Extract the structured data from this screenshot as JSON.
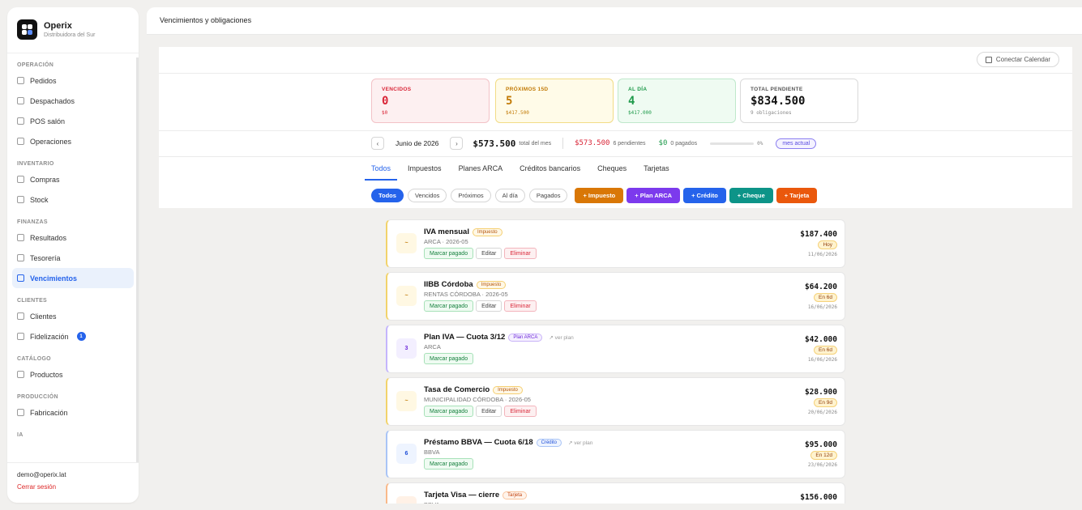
{
  "brand": {
    "name": "Operix",
    "subtitle": "Distribuidora del Sur"
  },
  "sidebar": {
    "sections": [
      {
        "title": "OPERACIÓN",
        "items": [
          {
            "label": "Pedidos",
            "icon": "box-icon"
          },
          {
            "label": "Despachados",
            "icon": "truck-icon"
          },
          {
            "label": "POS salón",
            "icon": "cart-icon"
          },
          {
            "label": "Operaciones",
            "icon": "clipboard-icon"
          }
        ]
      },
      {
        "title": "INVENTARIO",
        "items": [
          {
            "label": "Compras",
            "icon": "bag-icon"
          },
          {
            "label": "Stock",
            "icon": "stack-icon"
          }
        ]
      },
      {
        "title": "FINANZAS",
        "items": [
          {
            "label": "Resultados",
            "icon": "bar-chart-icon"
          },
          {
            "label": "Tesorería",
            "icon": "bank-icon"
          },
          {
            "label": "Vencimientos",
            "icon": "calendar-icon",
            "active": true
          }
        ]
      },
      {
        "title": "CLIENTES",
        "items": [
          {
            "label": "Clientes",
            "icon": "users-icon"
          },
          {
            "label": "Fidelización",
            "icon": "star-icon",
            "badge": "1"
          }
        ]
      },
      {
        "title": "CATÁLOGO",
        "items": [
          {
            "label": "Productos",
            "icon": "tag-icon"
          }
        ]
      },
      {
        "title": "PRODUCCIÓN",
        "items": [
          {
            "label": "Fabricación",
            "icon": "wrench-icon"
          }
        ]
      },
      {
        "title": "IA",
        "items": []
      }
    ],
    "footer": {
      "email": "demo@operix.lat",
      "logout": "Cerrar sesión"
    }
  },
  "header": {
    "title": "Vencimientos y obligaciones"
  },
  "calendar_button": "Conectar Calendar",
  "kpis": [
    {
      "label": "VENCIDOS",
      "value": "0",
      "sub": "$0"
    },
    {
      "label": "PRÓXIMOS 15D",
      "value": "5",
      "sub": "$417.500"
    },
    {
      "label": "AL DÍA",
      "value": "4",
      "sub": "$417.000"
    },
    {
      "label": "TOTAL PENDIENTE",
      "value": "$834.500",
      "sub": "9 obligaciones"
    }
  ],
  "month_bar": {
    "prev": "‹",
    "next": "›",
    "month": "Junio de 2026",
    "total": "$573.500",
    "total_label": "total del mes",
    "pending_amount": "$573.500",
    "pending_label": "6 pendientes",
    "paid_amount": "$0",
    "paid_label": "0 pagados",
    "progress": 0,
    "percent": "0%",
    "current_button": "mes actual"
  },
  "tabs": [
    "Todos",
    "Impuestos",
    "Planes ARCA",
    "Créditos bancarios",
    "Cheques",
    "Tarjetas"
  ],
  "filters": [
    "Todos",
    "Vencidos",
    "Próximos",
    "Al día",
    "Pagados"
  ],
  "add_buttons": [
    "+ Impuesto",
    "+ Plan ARCA",
    "+ Crédito",
    "+ Cheque",
    "+ Tarjeta"
  ],
  "actions": {
    "paid": "Marcar pagado",
    "edit": "Editar",
    "delete": "Eliminar",
    "view_plan": "↗ ver plan"
  },
  "obligations": [
    {
      "marker": "~",
      "name": "IVA mensual",
      "tag": "Impuesto",
      "sub": "ARCA · 2026-05",
      "amount": "$187.400",
      "due": "Hoy",
      "date": "11/06/2026",
      "kind": "imp"
    },
    {
      "marker": "~",
      "name": "IIBB Córdoba",
      "tag": "Impuesto",
      "sub": "RENTAS CÓRDOBA · 2026-05",
      "amount": "$64.200",
      "due": "En 6d",
      "date": "16/06/2026",
      "kind": "imp"
    },
    {
      "marker": "3",
      "name": "Plan IVA — Cuota 3/12",
      "tag": "Plan ARCA",
      "sub": "ARCA",
      "amount": "$42.000",
      "due": "En 6d",
      "date": "16/06/2026",
      "kind": "arca"
    },
    {
      "marker": "~",
      "name": "Tasa de Comercio",
      "tag": "Impuesto",
      "sub": "MUNICIPALIDAD CÓRDOBA · 2026-05",
      "amount": "$28.900",
      "due": "En 9d",
      "date": "20/06/2026",
      "kind": "imp"
    },
    {
      "marker": "6",
      "name": "Préstamo BBVA — Cuota 6/18",
      "tag": "Crédito",
      "sub": "BBVA",
      "amount": "$95.000",
      "due": "En 12d",
      "date": "23/06/2026",
      "kind": "cred"
    },
    {
      "marker": "~",
      "name": "Tarjeta Visa — cierre",
      "tag": "Tarjeta",
      "sub": "BBVA",
      "amount": "$156.000",
      "due": "",
      "date": "",
      "kind": "tarj"
    }
  ],
  "colors": {
    "accent": "#2563eb",
    "danger": "#d92638",
    "warning": "#c27a06",
    "success": "#1f9a4b"
  }
}
